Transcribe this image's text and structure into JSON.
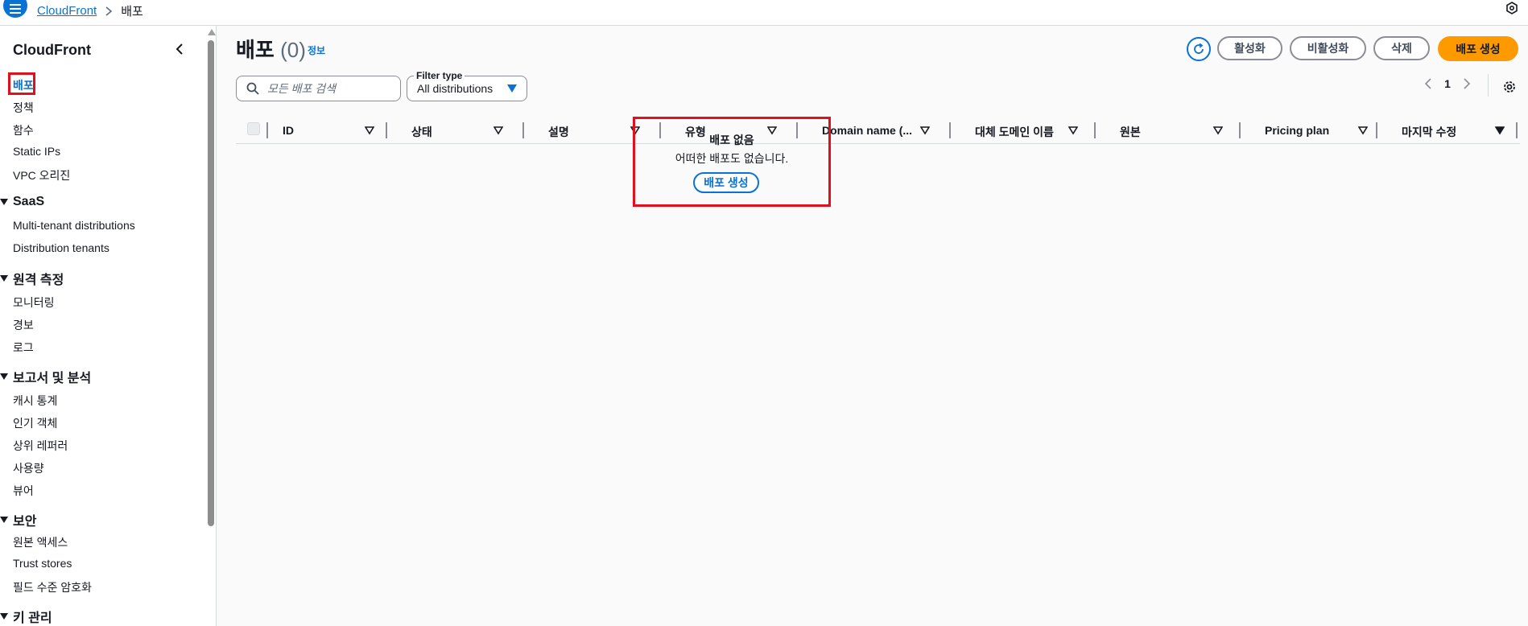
{
  "breadcrumb": {
    "items": [
      "CloudFront",
      "배포"
    ]
  },
  "sidebar": {
    "title": "CloudFront",
    "links": [
      "배포",
      "정책",
      "함수",
      "Static IPs",
      "VPC 오리진"
    ],
    "sections": [
      {
        "title": "SaaS",
        "items": [
          "Multi-tenant distributions",
          "Distribution tenants"
        ]
      },
      {
        "title": "원격 측정",
        "items": [
          "모니터링",
          "경보",
          "로그"
        ]
      },
      {
        "title": "보고서 및 분석",
        "items": [
          "캐시 통계",
          "인기 객체",
          "상위 레퍼러",
          "사용량",
          "뷰어"
        ]
      },
      {
        "title": "보안",
        "items": [
          "원본 액세스",
          "Trust stores",
          "필드 수준 암호화"
        ]
      },
      {
        "title": "키 관리",
        "items": []
      }
    ]
  },
  "header": {
    "title": "배포",
    "count": "(0)",
    "info": "정보"
  },
  "actions": {
    "enable": "활성화",
    "disable": "비활성화",
    "delete": "삭제",
    "create": "배포 생성"
  },
  "search": {
    "placeholder": "모든 배포 검색"
  },
  "filter": {
    "label": "Filter type",
    "value": "All distributions"
  },
  "pagination": {
    "current_page": "1"
  },
  "table": {
    "columns": [
      "ID",
      "상태",
      "설명",
      "유형",
      "Domain name (...",
      "대체 도메인 이름",
      "원본",
      "Pricing plan",
      "마지막 수정"
    ]
  },
  "empty_state": {
    "title": "배포 없음",
    "message": "어떠한 배포도 없습니다.",
    "button": "배포 생성"
  },
  "colors": {
    "accent": "#0972d3",
    "primary_button": "#ff9900",
    "highlight_border": "#e0111c"
  },
  "icons": [
    "menu-icon",
    "chevron-right-icon",
    "feedback-icon",
    "chevron-left-icon",
    "refresh-icon",
    "search-icon",
    "caret-down-icon",
    "settings-gear-icon",
    "sort-icon"
  ]
}
